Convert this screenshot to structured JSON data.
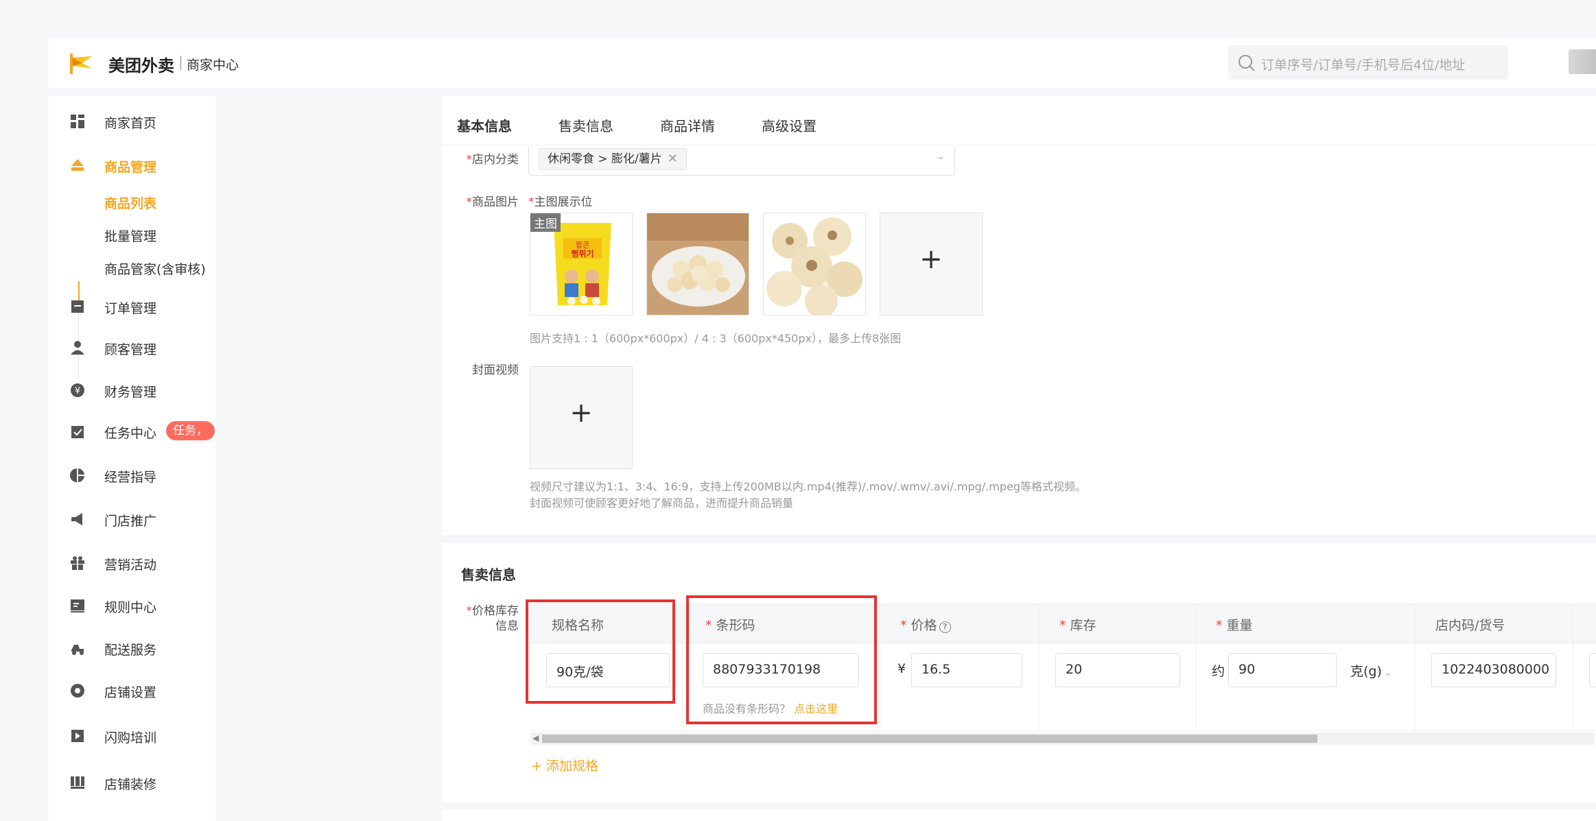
{
  "header": {
    "brand": "美团外卖",
    "separator": "|",
    "subtitle": "商家中心",
    "search_placeholder": "订单序号/订单号/手机号后4位/地址"
  },
  "sidebar": {
    "items": [
      {
        "label": "商家首页",
        "icon": "dashboard-icon"
      },
      {
        "label": "商品管理",
        "icon": "product-icon"
      },
      {
        "label": "订单管理",
        "icon": "order-icon"
      },
      {
        "label": "顾客管理",
        "icon": "customer-icon"
      },
      {
        "label": "财务管理",
        "icon": "finance-icon"
      },
      {
        "label": "任务中心",
        "icon": "task-icon"
      },
      {
        "label": "经营指导",
        "icon": "chart-icon"
      },
      {
        "label": "门店推广",
        "icon": "megaphone-icon"
      },
      {
        "label": "营销活动",
        "icon": "gift-icon"
      },
      {
        "label": "规则中心",
        "icon": "rules-icon"
      },
      {
        "label": "配送服务",
        "icon": "delivery-icon"
      },
      {
        "label": "店铺设置",
        "icon": "settings-icon"
      },
      {
        "label": "闪购培训",
        "icon": "training-icon"
      },
      {
        "label": "店铺装修",
        "icon": "decoration-icon"
      }
    ],
    "sub_items": [
      "商品列表",
      "批量管理",
      "商品管家(含审核)"
    ],
    "task_badge": "任务，"
  },
  "tabs": [
    "基本信息",
    "售卖信息",
    "商品详情",
    "高级设置"
  ],
  "basic": {
    "category_label": "店内分类",
    "category_value": "休闲零食 > 膨化/薯片",
    "image_label": "商品图片",
    "main_display_label": "主图展示位",
    "main_tag": "主图",
    "image_hint": "图片支持1 : 1（600px*600px）/ 4 : 3（600px*450px），最多上传8张图",
    "video_label": "封面视频",
    "video_hint_1": "视频尺寸建议为1:1、3:4、16:9，支持上传200MB以内.mp4(推荐)/.mov/.wmv/.avi/.mpg/.mpeg等格式视频。",
    "video_hint_2": "封面视频可使顾客更好地了解商品，进而提升商品销量",
    "plus": "+"
  },
  "sales": {
    "title": "售卖信息",
    "price_stock_label_1": "价格库存",
    "price_stock_label_2": "信息",
    "columns": {
      "spec_name": "规格名称",
      "barcode": "条形码",
      "price": "价格",
      "stock": "库存",
      "weight": "重量",
      "store_code": "店内码/货号"
    },
    "row": {
      "spec_name": "90克/袋",
      "barcode": "8807933170198",
      "currency": "¥",
      "price": "16.5",
      "stock": "20",
      "weight_prefix": "约",
      "weight": "90",
      "weight_unit": "克(g)",
      "store_code": "1022403080000"
    },
    "no_barcode_text": "商品没有条形码？",
    "no_barcode_link": "点击这里",
    "add_spec": "+ 添加规格"
  },
  "colors": {
    "accent": "#f5a623",
    "highlight_box": "#e8332f",
    "required": "#f04134"
  }
}
